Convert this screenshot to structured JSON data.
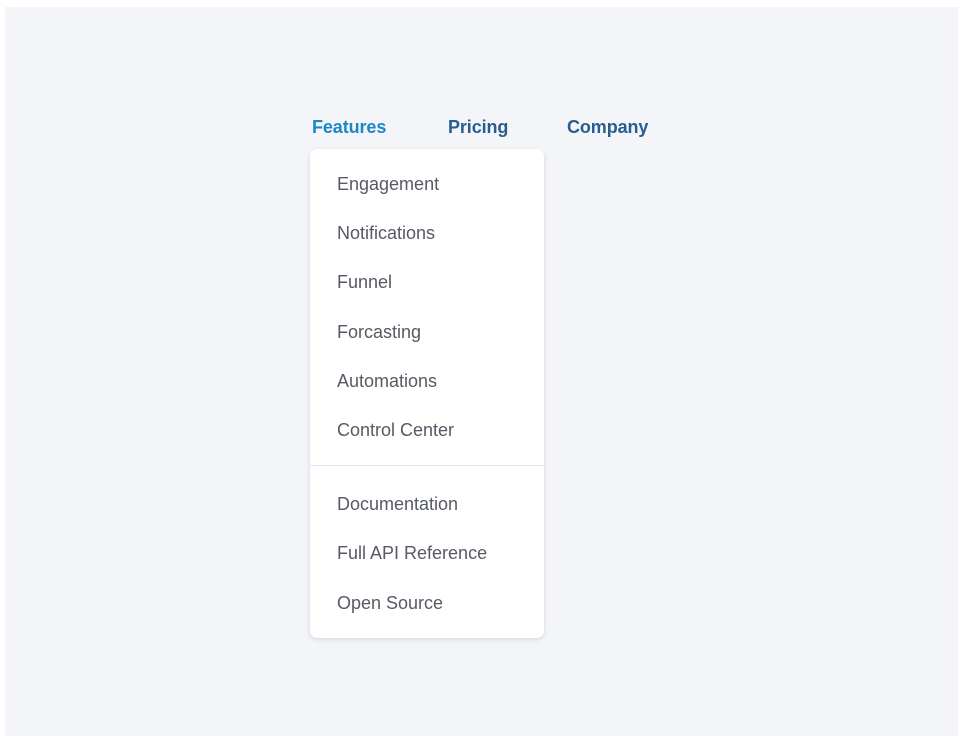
{
  "colors": {
    "background": "#f4f5f9",
    "nav_active": "#1d87c5",
    "nav_default": "#2a5d8f",
    "menu_text": "#555a63",
    "dropdown_bg": "#ffffff",
    "divider": "#e6e8ee"
  },
  "nav": {
    "items": [
      {
        "label": "Features",
        "active": true
      },
      {
        "label": "Pricing",
        "active": false
      },
      {
        "label": "Company",
        "active": false
      }
    ]
  },
  "dropdown": {
    "primary_items": [
      {
        "label": "Engagement"
      },
      {
        "label": "Notifications"
      },
      {
        "label": "Funnel"
      },
      {
        "label": "Forcasting"
      },
      {
        "label": "Automations"
      },
      {
        "label": "Control Center"
      }
    ],
    "secondary_items": [
      {
        "label": "Documentation"
      },
      {
        "label": "Full API Reference"
      },
      {
        "label": "Open Source"
      }
    ]
  }
}
